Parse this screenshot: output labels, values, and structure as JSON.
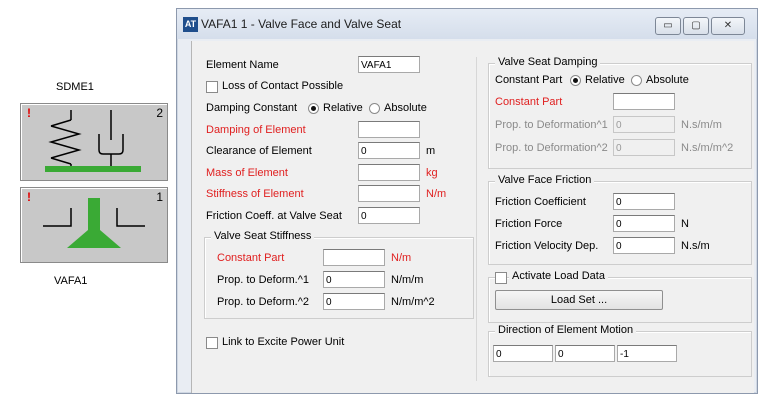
{
  "canvas": {
    "sdme_label": "SDME1",
    "vafa_label": "VAFA1",
    "block1_number": "2",
    "block2_number": "1",
    "warning_mark": "!"
  },
  "window": {
    "title": "VAFA1 1 - Valve Face and Valve Seat",
    "icon_text": "AT",
    "minimize_glyph": "▭",
    "maximize_glyph": "▢",
    "close_glyph": "✕"
  },
  "left": {
    "element_name_label": "Element Name",
    "element_name_value": "VAFA1",
    "loss_of_contact_label": "Loss of Contact Possible",
    "damping_constant_label": "Damping Constant",
    "relative_label": "Relative",
    "absolute_label": "Absolute",
    "damping_of_element_label": "Damping of Element",
    "damping_of_element_value": "",
    "clearance_label": "Clearance of Element",
    "clearance_value": "0",
    "clearance_unit": "m",
    "mass_label": "Mass of Element",
    "mass_value": "",
    "mass_unit": "kg",
    "stiffness_label": "Stiffness of Element",
    "stiffness_value": "",
    "stiffness_unit": "N/m",
    "friction_coeff_label": "Friction Coeff. at Valve Seat",
    "friction_coeff_value": "0",
    "vss_group_title": "Valve Seat Stiffness",
    "vss_constant_label": "Constant Part",
    "vss_constant_value": "",
    "vss_constant_unit": "N/m",
    "vss_deform1_label": "Prop. to Deform.^1",
    "vss_deform1_value": "0",
    "vss_deform1_unit": "N/m/m",
    "vss_deform2_label": "Prop. to Deform.^2",
    "vss_deform2_value": "0",
    "vss_deform2_unit": "N/m/m^2",
    "link_power_label": "Link to Excite Power Unit"
  },
  "right": {
    "vsd_group_title": "Valve Seat Damping",
    "vsd_constant_part_label": "Constant Part",
    "relative_label": "Relative",
    "absolute_label": "Absolute",
    "vsd_constant_label": "Constant Part",
    "vsd_constant_value": "",
    "vsd_deform1_label": "Prop. to Deformation^1",
    "vsd_deform1_value": "0",
    "vsd_deform1_unit": "N.s/m/m",
    "vsd_deform2_label": "Prop. to Deformation^2",
    "vsd_deform2_value": "0",
    "vsd_deform2_unit": "N.s/m/m^2",
    "vff_group_title": "Valve Face Friction",
    "friction_coefficient_label": "Friction Coefficient",
    "friction_coefficient_value": "0",
    "friction_force_label": "Friction Force",
    "friction_force_value": "0",
    "friction_force_unit": "N",
    "friction_velocity_label": "Friction Velocity Dep.",
    "friction_velocity_value": "0",
    "friction_velocity_unit": "N.s/m",
    "activate_load_label": "Activate Load Data",
    "load_set_button": "Load Set ...",
    "direction_group_title": "Direction of Element Motion",
    "direction_x": "0",
    "direction_y": "0",
    "direction_z": "-1"
  }
}
